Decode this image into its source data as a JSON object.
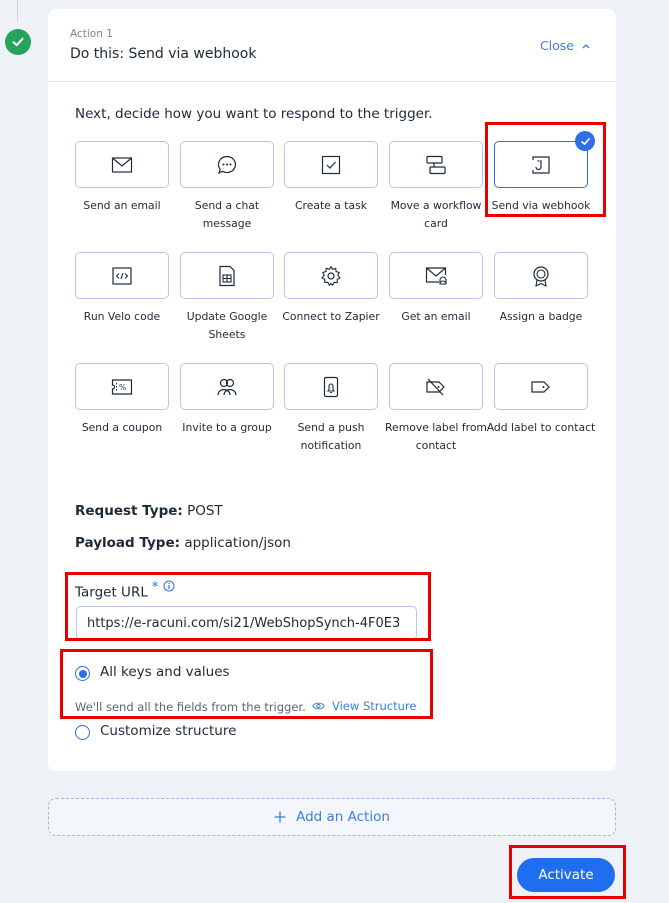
{
  "step": {
    "icon": "check-icon"
  },
  "header": {
    "kicker": "Action 1",
    "title": "Do this: Send via webhook",
    "close_label": "Close",
    "close_icon": "chevron-up-icon"
  },
  "prompt": "Next, decide how you want to respond to the trigger.",
  "actions": [
    {
      "label": "Send an email",
      "icon": "envelope-icon"
    },
    {
      "label": "Send a chat message",
      "icon": "chat-bubble-icon"
    },
    {
      "label": "Create a task",
      "icon": "checkbox-icon"
    },
    {
      "label": "Move a workflow card",
      "icon": "workflow-card-icon"
    },
    {
      "label": "Send via webhook",
      "icon": "webhook-icon",
      "selected": true
    },
    {
      "label": "Run Velo code",
      "icon": "code-icon"
    },
    {
      "label": "Update Google Sheets",
      "icon": "spreadsheet-icon"
    },
    {
      "label": "Connect to Zapier",
      "icon": "gear-icon"
    },
    {
      "label": "Get an email",
      "icon": "envelope-bell-icon"
    },
    {
      "label": "Assign a badge",
      "icon": "badge-icon"
    },
    {
      "label": "Send a coupon",
      "icon": "coupon-icon"
    },
    {
      "label": "Invite to a group",
      "icon": "group-icon"
    },
    {
      "label": "Send a push notification",
      "icon": "phone-bell-icon"
    },
    {
      "label": "Remove label from contact",
      "icon": "tag-remove-icon"
    },
    {
      "label": "Add label to contact",
      "icon": "tag-icon"
    }
  ],
  "request": {
    "type_label": "Request Type:",
    "type_value": "POST",
    "payload_label": "Payload Type:",
    "payload_value": "application/json"
  },
  "target": {
    "label": "Target URL",
    "required_mark": "*",
    "url": "https://e-racuni.com/si21/WebShopSynch-4F0E3"
  },
  "structure": {
    "option_all": "All keys and values",
    "help_text": "We'll send all the fields from the trigger.",
    "view_link": "View Structure",
    "option_custom": "Customize structure",
    "selected": "all"
  },
  "footer": {
    "add_action": "Add an Action",
    "activate": "Activate"
  },
  "colors": {
    "accent": "#1f6ef0",
    "success": "#25a35a",
    "highlight": "#e60000"
  }
}
